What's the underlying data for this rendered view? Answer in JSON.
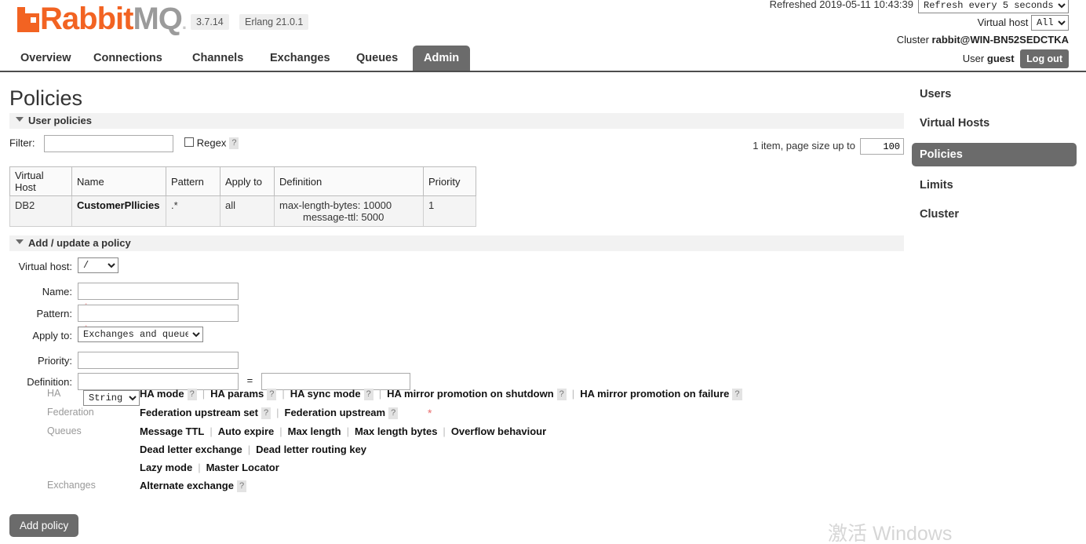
{
  "header": {
    "logo_rabbit": "Rabbit",
    "logo_mq": "MQ",
    "version": "3.7.14",
    "erlang": "Erlang 21.0.1",
    "refreshed_label": "Refreshed 2019-05-11 10:43:39",
    "refresh_select": "Refresh every 5 seconds",
    "vhost_label": "Virtual host",
    "vhost_value": "All",
    "cluster_label": "Cluster",
    "cluster_name": "rabbit@WIN-BN52SEDCTKA",
    "user_label": "User",
    "user_name": "guest",
    "logout": "Log out"
  },
  "tabs": [
    {
      "label": "Overview",
      "active": false
    },
    {
      "label": "Connections",
      "active": false
    },
    {
      "label": "Channels",
      "active": false
    },
    {
      "label": "Exchanges",
      "active": false
    },
    {
      "label": "Queues",
      "active": false
    },
    {
      "label": "Admin",
      "active": true
    }
  ],
  "page": {
    "title": "Policies"
  },
  "user_policies": {
    "section_title": "User policies",
    "filter_label": "Filter:",
    "filter_value": "",
    "regex_label": "Regex",
    "help": "?",
    "pager_text": "1 item, page size up to",
    "page_size": "100",
    "columns": [
      "Virtual Host",
      "Name",
      "Pattern",
      "Apply to",
      "Definition",
      "Priority"
    ],
    "rows": [
      {
        "vhost": "DB2",
        "name": "CustomerPllicies",
        "pattern": ".*",
        "apply_to": "all",
        "definition_1": "max-length-bytes: 10000",
        "definition_2": "message-ttl: 5000",
        "priority": "1"
      }
    ]
  },
  "add_policy": {
    "section_title": "Add / update a policy",
    "vhost_label": "Virtual host:",
    "vhost_value": "/",
    "name_label": "Name:",
    "name_value": "",
    "pattern_label": "Pattern:",
    "pattern_value": "",
    "apply_to_label": "Apply to:",
    "apply_to_value": "Exchanges and queues",
    "priority_label": "Priority:",
    "priority_value": "",
    "definition_label": "Definition:",
    "definition_key": "",
    "definition_value": "",
    "definition_type": "String",
    "equals": "=",
    "required_mark": "*",
    "submit_label": "Add policy",
    "groups": [
      {
        "label": "HA",
        "lines": [
          [
            {
              "label": "HA mode",
              "help": "?"
            },
            {
              "label": "HA params",
              "help": "?"
            },
            {
              "label": "HA sync mode",
              "help": "?"
            },
            {
              "label": "HA mirror promotion on shutdown",
              "help": "?"
            },
            {
              "label": "HA mirror promotion on failure",
              "help": "?",
              "nosep": true
            }
          ]
        ]
      },
      {
        "label": "Federation",
        "lines": [
          [
            {
              "label": "Federation upstream set",
              "help": "?"
            },
            {
              "label": "Federation upstream",
              "help": "?",
              "nosep": true
            }
          ]
        ]
      },
      {
        "label": "Queues",
        "lines": [
          [
            {
              "label": "Message TTL"
            },
            {
              "label": "Auto expire"
            },
            {
              "label": "Max length"
            },
            {
              "label": "Max length bytes"
            },
            {
              "label": "Overflow behaviour"
            }
          ],
          [
            {
              "label": "Dead letter exchange"
            },
            {
              "label": "Dead letter routing key"
            }
          ],
          [
            {
              "label": "Lazy mode"
            },
            {
              "label": "Master Locator"
            }
          ]
        ]
      },
      {
        "label": "Exchanges",
        "lines": [
          [
            {
              "label": "Alternate exchange",
              "help": "?",
              "nosep": true
            }
          ]
        ]
      }
    ]
  },
  "sidebar": {
    "items": [
      {
        "label": "Users",
        "active": false
      },
      {
        "label": "Virtual Hosts",
        "active": false
      },
      {
        "label": "Policies",
        "active": true
      },
      {
        "label": "Limits",
        "active": false
      },
      {
        "label": "Cluster",
        "active": false
      }
    ]
  },
  "watermark": {
    "text": "激活 Windows"
  }
}
